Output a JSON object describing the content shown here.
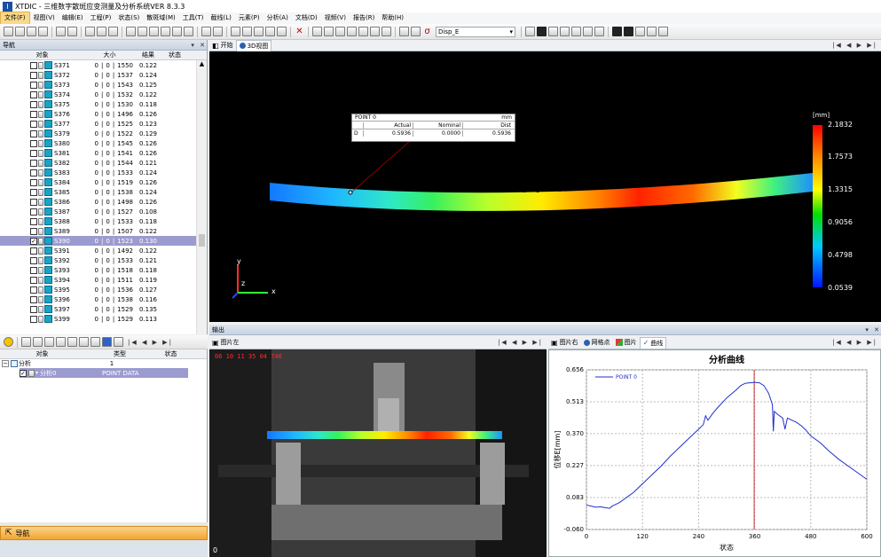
{
  "app": {
    "title": "XTDIC - 三维数字散斑应变测量及分析系统VER 8.3.3",
    "icon_letter": "I"
  },
  "menu": [
    "文件(F)",
    "视图(V)",
    "编辑(E)",
    "工程(P)",
    "状态(S)",
    "散斑域(M)",
    "工具(T)",
    "截线(L)",
    "元素(P)",
    "分析(A)",
    "文档(D)",
    "视频(V)",
    "报告(R)",
    "帮助(H)"
  ],
  "toolbar": {
    "display_select": "Disp_E"
  },
  "nav": {
    "title": "导航",
    "columns": [
      "对象",
      "大小",
      "结果",
      "状态"
    ],
    "rows": [
      {
        "name": "S371",
        "a": "0",
        "b": "0",
        "c": "1550",
        "r": "0.122",
        "checked": false
      },
      {
        "name": "S372",
        "a": "0",
        "b": "0",
        "c": "1537",
        "r": "0.124",
        "checked": false
      },
      {
        "name": "S373",
        "a": "0",
        "b": "0",
        "c": "1543",
        "r": "0.125",
        "checked": false
      },
      {
        "name": "S374",
        "a": "0",
        "b": "0",
        "c": "1532",
        "r": "0.122",
        "checked": false
      },
      {
        "name": "S375",
        "a": "0",
        "b": "0",
        "c": "1530",
        "r": "0.118",
        "checked": false
      },
      {
        "name": "S376",
        "a": "0",
        "b": "0",
        "c": "1496",
        "r": "0.126",
        "checked": false
      },
      {
        "name": "S377",
        "a": "0",
        "b": "0",
        "c": "1525",
        "r": "0.123",
        "checked": false
      },
      {
        "name": "S379",
        "a": "0",
        "b": "0",
        "c": "1522",
        "r": "0.129",
        "checked": false
      },
      {
        "name": "S380",
        "a": "0",
        "b": "0",
        "c": "1545",
        "r": "0.126",
        "checked": false
      },
      {
        "name": "S381",
        "a": "0",
        "b": "0",
        "c": "1541",
        "r": "0.126",
        "checked": false
      },
      {
        "name": "S382",
        "a": "0",
        "b": "0",
        "c": "1544",
        "r": "0.121",
        "checked": false
      },
      {
        "name": "S383",
        "a": "0",
        "b": "0",
        "c": "1533",
        "r": "0.124",
        "checked": false
      },
      {
        "name": "S384",
        "a": "0",
        "b": "0",
        "c": "1519",
        "r": "0.126",
        "checked": false
      },
      {
        "name": "S385",
        "a": "0",
        "b": "0",
        "c": "1538",
        "r": "0.124",
        "checked": false
      },
      {
        "name": "S386",
        "a": "0",
        "b": "0",
        "c": "1498",
        "r": "0.126",
        "checked": false
      },
      {
        "name": "S387",
        "a": "0",
        "b": "0",
        "c": "1527",
        "r": "0.108",
        "checked": false
      },
      {
        "name": "S388",
        "a": "0",
        "b": "0",
        "c": "1533",
        "r": "0.118",
        "checked": false
      },
      {
        "name": "S389",
        "a": "0",
        "b": "0",
        "c": "1507",
        "r": "0.122",
        "checked": false
      },
      {
        "name": "S390",
        "a": "0",
        "b": "0",
        "c": "1523",
        "r": "0.130",
        "checked": true,
        "selected": true
      },
      {
        "name": "S391",
        "a": "0",
        "b": "0",
        "c": "1492",
        "r": "0.122",
        "checked": false
      },
      {
        "name": "S392",
        "a": "0",
        "b": "0",
        "c": "1533",
        "r": "0.121",
        "checked": false
      },
      {
        "name": "S393",
        "a": "0",
        "b": "0",
        "c": "1518",
        "r": "0.118",
        "checked": false
      },
      {
        "name": "S394",
        "a": "0",
        "b": "0",
        "c": "1511",
        "r": "0.119",
        "checked": false
      },
      {
        "name": "S395",
        "a": "0",
        "b": "0",
        "c": "1536",
        "r": "0.127",
        "checked": false
      },
      {
        "name": "S396",
        "a": "0",
        "b": "0",
        "c": "1538",
        "r": "0.116",
        "checked": false
      },
      {
        "name": "S397",
        "a": "0",
        "b": "0",
        "c": "1529",
        "r": "0.135",
        "checked": false
      },
      {
        "name": "S399",
        "a": "0",
        "b": "0",
        "c": "1529",
        "r": "0.113",
        "checked": false
      }
    ]
  },
  "elements": {
    "columns": [
      "对象",
      "类型",
      "状态"
    ],
    "group_label": "分析",
    "group_count": "1",
    "item_name": "分析0",
    "item_type": "POINT DATA"
  },
  "bottom_nav": {
    "label": "导航"
  },
  "view3d": {
    "tabs": [
      "开始",
      "3D视图"
    ],
    "point": {
      "name": "POINT 0",
      "unit": "mm",
      "headers": [
        "Actual",
        "Nominal",
        "Dist"
      ],
      "row_label": "D",
      "actual": "0.5936",
      "nominal": "0.0000",
      "dist": "0.5936"
    },
    "colorbar": {
      "unit": "[mm]",
      "labels": [
        "2.1832",
        "1.7573",
        "1.3315",
        "0.9056",
        "0.4798",
        "0.0539"
      ]
    },
    "axis": {
      "x": "x",
      "y": "y",
      "z": "z"
    }
  },
  "output": {
    "title": "输出"
  },
  "image_left": {
    "tab": "图片左",
    "timestamp": "06 10 11 35 04 746",
    "frame": "0"
  },
  "right_tabs": [
    "图片右",
    "网格点",
    "图片",
    "曲线"
  ],
  "chart_data": {
    "type": "line",
    "title": "分析曲线",
    "xlabel": "状态",
    "ylabel": "位移E[mm]",
    "xlim": [
      0,
      600
    ],
    "ylim": [
      -0.06,
      0.656
    ],
    "x_ticks": [
      0,
      120,
      240,
      360,
      480,
      600
    ],
    "y_ticks": [
      "-0.060",
      "0.083",
      "0.227",
      "0.370",
      "0.513",
      "0.656"
    ],
    "marker_x": 359,
    "series": [
      {
        "name": "POINT 0",
        "color": "#1f2fcf",
        "x": [
          0,
          10,
          20,
          30,
          40,
          50,
          55,
          60,
          70,
          80,
          90,
          100,
          110,
          120,
          140,
          160,
          180,
          200,
          220,
          240,
          250,
          255,
          260,
          270,
          280,
          300,
          320,
          330,
          340,
          350,
          360,
          370,
          380,
          390,
          398,
          400,
          402,
          410,
          420,
          425,
          430,
          440,
          450,
          460,
          470,
          480,
          500,
          520,
          540,
          560,
          580,
          600
        ],
        "y": [
          0.05,
          0.045,
          0.04,
          0.042,
          0.038,
          0.035,
          0.045,
          0.05,
          0.06,
          0.075,
          0.09,
          0.105,
          0.125,
          0.145,
          0.185,
          0.225,
          0.27,
          0.31,
          0.35,
          0.39,
          0.41,
          0.45,
          0.43,
          0.46,
          0.485,
          0.53,
          0.565,
          0.585,
          0.596,
          0.598,
          0.6,
          0.598,
          0.585,
          0.55,
          0.5,
          0.38,
          0.47,
          0.455,
          0.44,
          0.39,
          0.44,
          0.43,
          0.42,
          0.405,
          0.385,
          0.36,
          0.33,
          0.29,
          0.255,
          0.225,
          0.195,
          0.165
        ]
      }
    ]
  }
}
